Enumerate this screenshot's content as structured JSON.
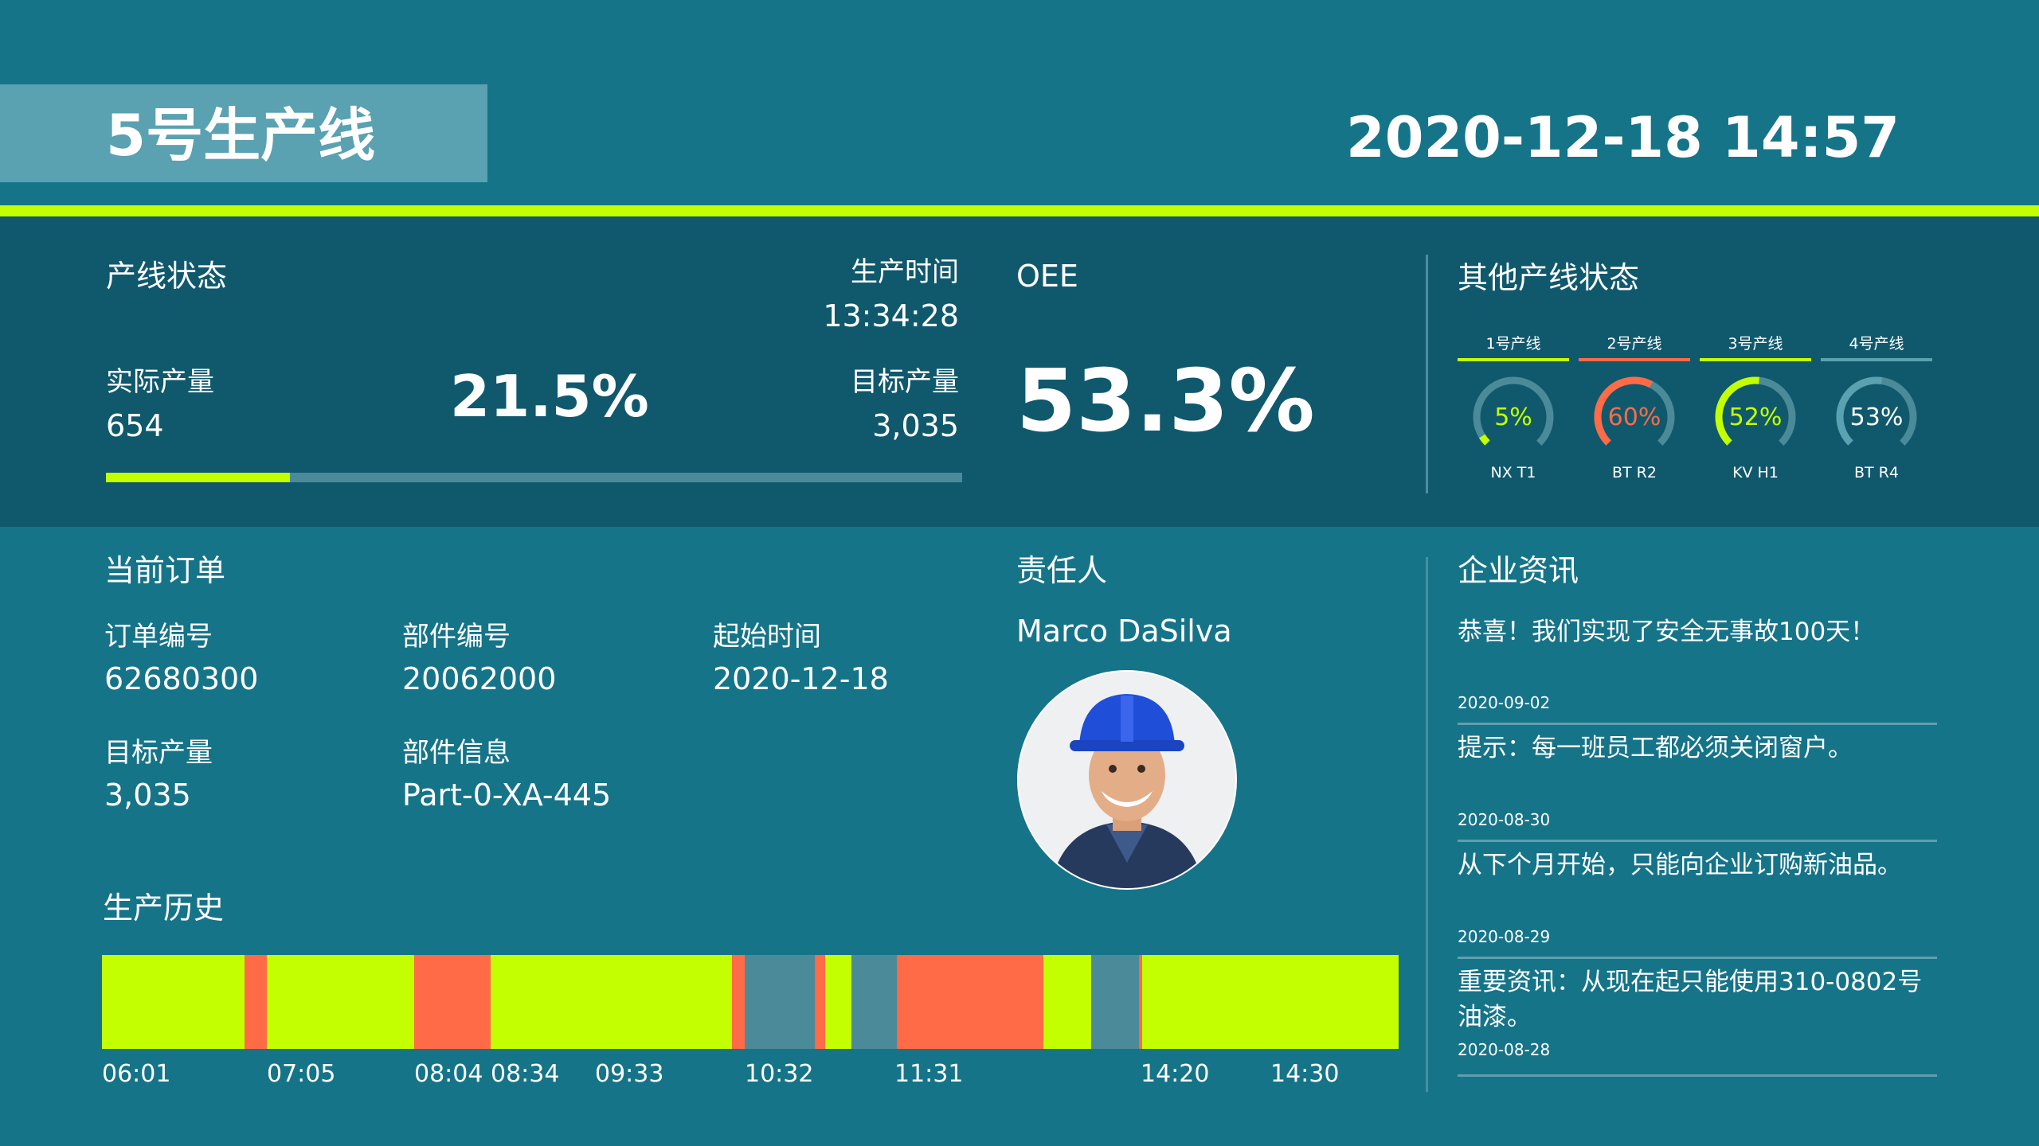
{
  "header": {
    "title": "5号生产线",
    "datetime": "2020-12-18 14:57"
  },
  "colors": {
    "background": "#167489",
    "band": "#10596d",
    "accent": "#c3ff00",
    "alert": "#ff6b47",
    "idle": "#4b8b99"
  },
  "line_status": {
    "title": "产线状态",
    "production_time_label": "生产时间",
    "production_time": "13:34:28",
    "actual_output_label": "实际产量",
    "actual_output": "654",
    "percent": "21.5%",
    "progress_fraction": 0.215,
    "target_output_label": "目标产量",
    "target_output": "3,035"
  },
  "oee": {
    "title": "OEE",
    "value": "53.3%"
  },
  "other_lines": {
    "title": "其他产线状态",
    "lines": [
      {
        "tab": "1号产线",
        "percent": "5%",
        "fraction": 0.05,
        "name": "NX T1",
        "color": "#c3ff00"
      },
      {
        "tab": "2号产线",
        "percent": "60%",
        "fraction": 0.6,
        "name": "BT R2",
        "color": "#ff6b47"
      },
      {
        "tab": "3号产线",
        "percent": "52%",
        "fraction": 0.52,
        "name": "KV H1",
        "color": "#c3ff00"
      },
      {
        "tab": "4号产线",
        "percent": "53%",
        "fraction": 0.53,
        "name": "BT R4",
        "color": "#5aa1b1"
      }
    ]
  },
  "current_order": {
    "title": "当前订单",
    "order_no_label": "订单编号",
    "order_no": "62680300",
    "part_no_label": "部件编号",
    "part_no": "20062000",
    "start_time_label": "起始时间",
    "start_time": "2020-12-18",
    "target_label": "目标产量",
    "target": "3,035",
    "part_info_label": "部件信息",
    "part_info": "Part-0-XA-445"
  },
  "responsible": {
    "title": "责任人",
    "name": "Marco DaSilva"
  },
  "history": {
    "title": "生产历史",
    "ticks": [
      "06:01",
      "07:05",
      "08:04",
      "08:34",
      "09:33",
      "10:32",
      "11:31",
      "14:20",
      "14:30"
    ],
    "segments": [
      {
        "share": 0.11,
        "state": "run"
      },
      {
        "share": 0.017,
        "state": "stop"
      },
      {
        "share": 0.114,
        "state": "run"
      },
      {
        "share": 0.059,
        "state": "stop"
      },
      {
        "share": 0.081,
        "state": "run"
      },
      {
        "share": 0.105,
        "state": "run"
      },
      {
        "share": 0.01,
        "state": "stop"
      },
      {
        "share": 0.054,
        "state": "idle"
      },
      {
        "share": 0.008,
        "state": "stop"
      },
      {
        "share": 0.02,
        "state": "run"
      },
      {
        "share": 0.035,
        "state": "idle"
      },
      {
        "share": 0.113,
        "state": "stop"
      },
      {
        "share": 0.037,
        "state": "run"
      },
      {
        "share": 0.037,
        "state": "idle"
      },
      {
        "share": 0.002,
        "state": "stop"
      },
      {
        "share": 0.1,
        "state": "run"
      },
      {
        "share": 0.098,
        "state": "run"
      }
    ]
  },
  "news": {
    "title": "企业资讯",
    "items": [
      {
        "text": "恭喜！我们实现了安全无事故100天！",
        "date": "2020-09-02"
      },
      {
        "text": "提示：每一班员工都必须关闭窗户。",
        "date": "2020-08-30"
      },
      {
        "text": "从下个月开始，只能向企业订购新油品。",
        "date": "2020-08-29"
      },
      {
        "text": "重要资讯：从现在起只能使用310-0802号油漆。",
        "date": "2020-08-28"
      }
    ]
  }
}
